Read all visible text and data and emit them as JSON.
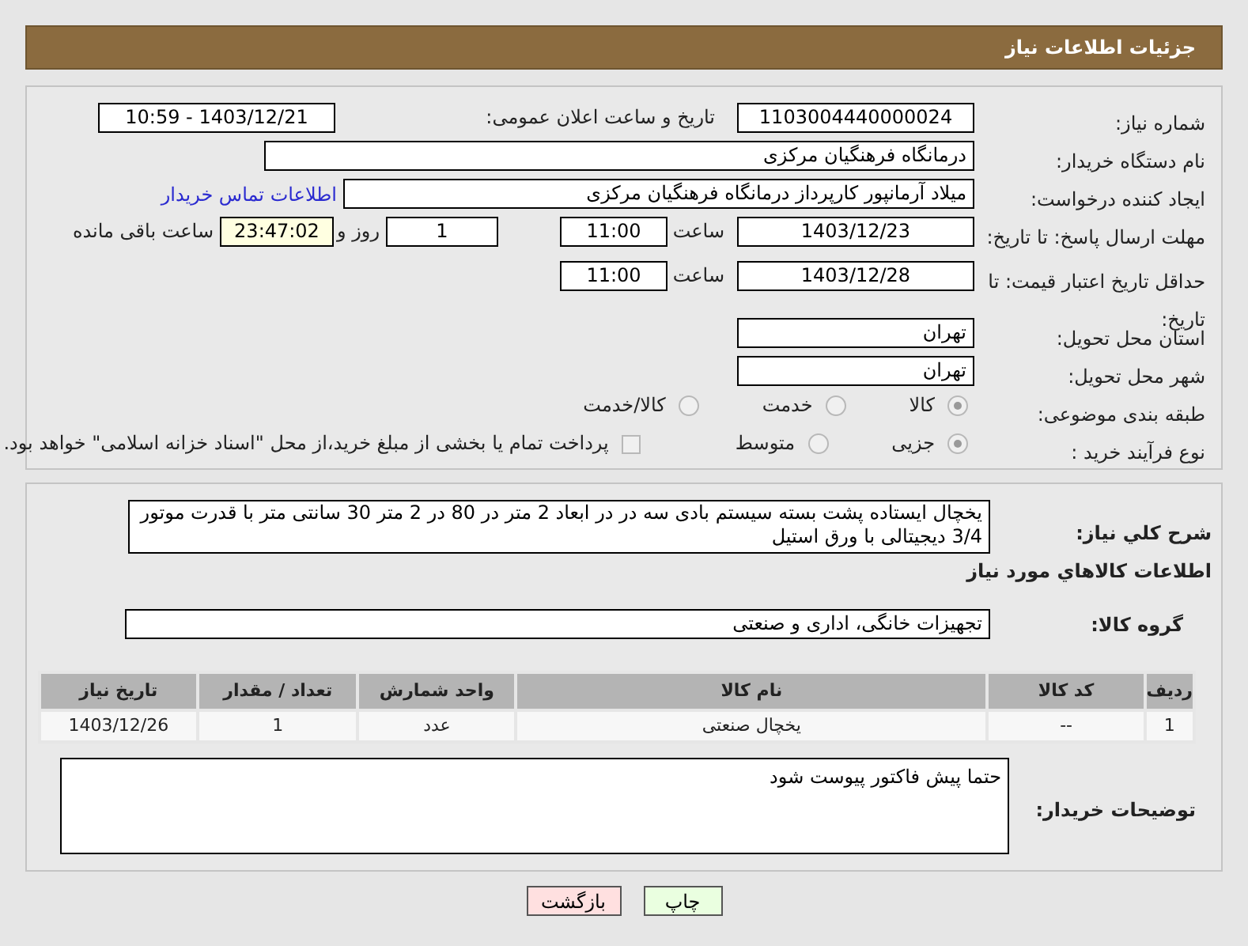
{
  "header": {
    "title": "جزئیات اطلاعات نیاز"
  },
  "need_number": {
    "label": "شماره نیاز:",
    "value": "1103004440000024"
  },
  "announce": {
    "label": "تاریخ و ساعت اعلان عمومی:",
    "value": "1403/12/21 - 10:59"
  },
  "buyer_org": {
    "label": "نام دستگاه خریدار:",
    "value": "درمانگاه فرهنگیان مرکزی"
  },
  "requester": {
    "label": "ایجاد کننده درخواست:",
    "value": "میلاد آرمانپور کارپرداز درمانگاه فرهنگیان مرکزی",
    "link": "اطلاعات تماس خریدار"
  },
  "reply_deadline": {
    "label": "مهلت ارسال پاسخ: تا تاریخ:",
    "date": "1403/12/23",
    "time_label": "ساعت",
    "time": "11:00",
    "days": "1",
    "days_label": "روز و",
    "remaining": "23:47:02",
    "remaining_label": "ساعت باقی مانده"
  },
  "price_validity": {
    "label": "حداقل تاریخ اعتبار قیمت: تا تاریخ:",
    "date": "1403/12/28",
    "time_label": "ساعت",
    "time": "11:00"
  },
  "province": {
    "label": "استان محل تحویل:",
    "value": "تهران"
  },
  "city": {
    "label": "شهر محل تحویل:",
    "value": "تهران"
  },
  "category": {
    "label": "طبقه بندی موضوعی:",
    "options": [
      {
        "label": "کالا",
        "selected": true
      },
      {
        "label": "خدمت",
        "selected": false
      },
      {
        "label": "کالا/خدمت",
        "selected": false
      }
    ]
  },
  "process": {
    "label": "نوع فرآیند خرید :",
    "options": [
      {
        "label": "جزیی",
        "selected": true
      },
      {
        "label": "متوسط",
        "selected": false
      }
    ],
    "payment_checkbox": {
      "checked": false,
      "label": "پرداخت تمام یا بخشی از مبلغ خرید،از محل \"اسناد خزانه اسلامی\" خواهد بود."
    }
  },
  "description": {
    "label": "شرح کلي نياز:",
    "value": "یخچال ایستاده پشت بسته سیستم بادی سه در در ابعاد 2 متر در 80 در 2 متر 30 سانتی متر با قدرت موتور 3/4 دیجیتالی با ورق استیل"
  },
  "goods_heading": "اطلاعات كالاهاي مورد نياز",
  "goods_group": {
    "label": "گروه کالا:",
    "value": "تجهیزات خانگی، اداری و صنعتی"
  },
  "table": {
    "columns": [
      "ردیف",
      "کد کالا",
      "نام کالا",
      "واحد شمارش",
      "تعداد / مقدار",
      "تاریخ نیاز"
    ],
    "rows": [
      [
        "1",
        "--",
        "یخچال صنعتی",
        "عدد",
        "1",
        "1403/12/26"
      ]
    ]
  },
  "buyer_notes": {
    "label": "توضیحات خریدار:",
    "value": "حتما پیش فاکتور پیوست شود"
  },
  "buttons": [
    {
      "label": "چاپ",
      "kind": "print"
    },
    {
      "label": "بازگشت",
      "kind": "back"
    }
  ]
}
